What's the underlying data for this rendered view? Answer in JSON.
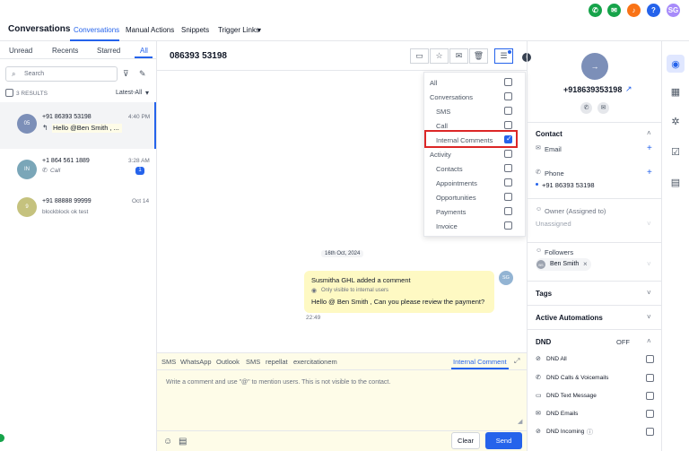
{
  "colors": {
    "accent": "#2563eb",
    "highlight": "#dc2626",
    "comment_bg": "#fefce8"
  },
  "topbar": {
    "icons": [
      {
        "name": "phone-icon",
        "glyph": "✆",
        "color": "#16a34a"
      },
      {
        "name": "megaphone-icon",
        "glyph": "✉",
        "color": "#16a34a"
      },
      {
        "name": "bell-icon",
        "glyph": "♪",
        "color": "#f97316"
      },
      {
        "name": "help-icon",
        "glyph": "?",
        "color": "#2563eb"
      }
    ],
    "user_initials": "SG"
  },
  "nav": {
    "title": "Conversations",
    "items": [
      "Conversations",
      "Manual Actions",
      "Snippets",
      "Trigger Links"
    ]
  },
  "left": {
    "tabs": [
      "Unread",
      "Recents",
      "Starred",
      "All"
    ],
    "search_placeholder": "Search",
    "results_label": "3 RESULTS",
    "sort_label": "Latest-All",
    "conversations": [
      {
        "initials": "05",
        "name": "+91 86393 53198",
        "time": "4:40 PM",
        "preview": "Hello @Ben Smith , ...",
        "color": "#7c8fb8"
      },
      {
        "initials": "IN",
        "name": "+1 864 561 1889",
        "time": "3:28 AM",
        "preview": "Call",
        "badge": "1",
        "color": "#7aa6b8"
      },
      {
        "initials": "9",
        "name": "+91 88888 99999",
        "time": "Oct 14",
        "preview": "blockblock ok test",
        "color": "#c5c27e"
      }
    ]
  },
  "center": {
    "phone": "086393 53198",
    "filter_menu": [
      {
        "label": "All",
        "indent": false,
        "checked": false
      },
      {
        "label": "Conversations",
        "indent": false,
        "checked": false
      },
      {
        "label": "SMS",
        "indent": true,
        "checked": false
      },
      {
        "label": "Call",
        "indent": true,
        "checked": false
      },
      {
        "label": "Internal Comments",
        "indent": true,
        "checked": true
      },
      {
        "label": "Activity",
        "indent": false,
        "checked": false
      },
      {
        "label": "Contacts",
        "indent": true,
        "checked": false
      },
      {
        "label": "Appointments",
        "indent": true,
        "checked": false
      },
      {
        "label": "Opportunities",
        "indent": true,
        "checked": false
      },
      {
        "label": "Payments",
        "indent": true,
        "checked": false
      },
      {
        "label": "Invoice",
        "indent": true,
        "checked": false
      }
    ],
    "date_divider": "16th Oct, 2024",
    "message": {
      "author": "Susmitha GHL added a comment",
      "visibility": "Only visible to internal users",
      "text": "Hello @ Ben Smith  , Can you please review the payment?",
      "time": "22:49",
      "initials": "SG"
    },
    "composer": {
      "tabs": [
        "SMS",
        "WhatsApp",
        "Outlook",
        "SMS",
        "repellat",
        "exercitationem"
      ],
      "active_tab": "Internal Comment",
      "placeholder": "Write a comment and use \"@\" to mention users. This is not visible to the contact.",
      "clear_label": "Clear",
      "send_label": "Send"
    }
  },
  "right": {
    "phone": "+918639353198",
    "contact_title": "Contact",
    "email_label": "Email",
    "phone_label": "Phone",
    "phone_value": "+91 86393 53198",
    "owner_label": "Owner (Assigned to)",
    "owner_value": "Unassigned",
    "followers_label": "Followers",
    "follower": "Ben Smith",
    "follower_initials": "BS",
    "tags_title": "Tags",
    "automations_title": "Active Automations",
    "dnd_title": "DND",
    "dnd_status": "OFF",
    "dnd_items": [
      "DND All",
      "DND Calls & Voicemails",
      "DND Text Message",
      "DND Emails",
      "DND Incoming"
    ]
  }
}
